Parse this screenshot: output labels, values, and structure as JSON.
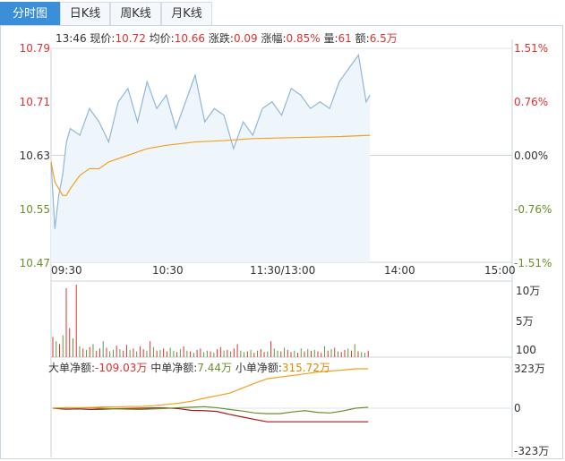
{
  "tabs": [
    {
      "label": "分时图",
      "active": true
    },
    {
      "label": "日K线",
      "active": false
    },
    {
      "label": "周K线",
      "active": false
    },
    {
      "label": "月K线",
      "active": false
    }
  ],
  "quote": {
    "time": "13:46",
    "price_label": "现价:",
    "price": "10.72",
    "avg_label": "均价:",
    "avg": "10.66",
    "change_label": "涨跌:",
    "change": "0.09",
    "pct_label": "涨幅:",
    "pct": "0.85%",
    "volume_label": "量:",
    "volume": "61",
    "amount_label": "额:",
    "amount": "6.5万"
  },
  "price_axis": [
    "10.79",
    "10.71",
    "10.63",
    "10.55",
    "10.47"
  ],
  "pct_axis": [
    "1.51%",
    "0.76%",
    "0.00%",
    "-0.76%",
    "-1.51%"
  ],
  "time_axis": [
    "09:30",
    "10:30",
    "11:30/13:00",
    "14:00",
    "15:00"
  ],
  "volume_axis": [
    "10万",
    "5万",
    "100"
  ],
  "money_flow": {
    "large_label": "大单净额:",
    "large": "-109.03万",
    "medium_label": "中单净额:",
    "medium": "7.44万",
    "small_label": "小单净额:",
    "small": "315.72万",
    "axis": [
      "323万",
      "0",
      "-323万"
    ]
  },
  "colors": {
    "up": "#e03131",
    "down": "#5a9a3a",
    "price_line": "#8fb6dd",
    "avg_line": "#f2a01e",
    "tab_active": "#3b8fd8"
  },
  "chart_data": {
    "type": "line",
    "title": "",
    "xlabel": "",
    "ylabel": "",
    "x_range": [
      "09:30",
      "15:00"
    ],
    "ylim": [
      10.47,
      10.79
    ],
    "prev_close": 10.63,
    "series": [
      {
        "name": "现价",
        "x": [
          "09:30",
          "09:32",
          "09:34",
          "09:36",
          "09:38",
          "09:40",
          "09:45",
          "09:50",
          "09:55",
          "10:00",
          "10:05",
          "10:10",
          "10:15",
          "10:20",
          "10:25",
          "10:30",
          "10:35",
          "10:40",
          "10:45",
          "10:50",
          "10:55",
          "11:00",
          "11:05",
          "11:10",
          "11:15",
          "11:20",
          "11:25",
          "11:30",
          "13:05",
          "13:10",
          "13:15",
          "13:20",
          "13:25",
          "13:30",
          "13:35",
          "13:40",
          "13:44",
          "13:46"
        ],
        "values": [
          10.62,
          10.52,
          10.57,
          10.6,
          10.65,
          10.67,
          10.66,
          10.7,
          10.68,
          10.65,
          10.71,
          10.73,
          10.68,
          10.74,
          10.7,
          10.72,
          10.67,
          10.71,
          10.75,
          10.68,
          10.7,
          10.69,
          10.64,
          10.68,
          10.66,
          10.7,
          10.71,
          10.69,
          10.73,
          10.72,
          10.7,
          10.71,
          10.7,
          10.74,
          10.76,
          10.78,
          10.71,
          10.72
        ]
      },
      {
        "name": "均价",
        "x": [
          "09:30",
          "09:32",
          "09:34",
          "09:36",
          "09:38",
          "09:40",
          "09:45",
          "09:50",
          "09:55",
          "10:00",
          "10:10",
          "10:20",
          "10:30",
          "10:45",
          "11:00",
          "11:15",
          "11:30",
          "13:15",
          "13:30",
          "13:46"
        ],
        "values": [
          10.62,
          10.59,
          10.58,
          10.57,
          10.57,
          10.58,
          10.6,
          10.61,
          10.61,
          10.62,
          10.63,
          10.64,
          10.645,
          10.65,
          10.652,
          10.655,
          10.656,
          10.657,
          10.658,
          10.66
        ]
      }
    ]
  },
  "volume_data": {
    "type": "bar",
    "ylim": [
      0,
      100000
    ],
    "values": [
      28000,
      22000,
      18000,
      30000,
      95000,
      40000,
      26000,
      100000,
      15000,
      12000,
      10000,
      14000,
      18000,
      9000,
      12000,
      22000,
      13000,
      8000,
      10000,
      16000,
      11000,
      9000,
      17000,
      10000,
      12000,
      8000,
      15000,
      11000,
      9000,
      22000,
      14000,
      9000,
      10000,
      12000,
      8000,
      13000,
      9000,
      7000,
      11000,
      15000,
      9000,
      8000,
      6000,
      10000,
      12000,
      7000,
      9000,
      8000,
      6000,
      11000,
      14000,
      9000,
      10000,
      8000,
      12000,
      18000,
      9000,
      7000,
      8000,
      10000,
      6000,
      9000,
      11000,
      7000,
      8000,
      22000,
      12000,
      9000,
      8000,
      13000,
      10000,
      7000,
      9000,
      6000,
      12000,
      8000,
      11000,
      9000,
      10000,
      8000,
      6000,
      15000,
      9000,
      11000,
      13000,
      8000,
      7000,
      10000,
      12000,
      9000,
      18000,
      8000,
      7000,
      6000,
      9000
    ],
    "up": [
      true,
      false,
      true,
      false,
      true,
      true,
      false,
      true,
      false,
      true,
      false,
      true,
      false,
      true,
      true,
      false,
      true,
      false,
      false,
      true,
      false,
      true,
      true,
      false,
      true,
      false,
      true,
      true,
      false,
      true,
      false,
      true,
      false,
      true,
      true,
      false,
      false,
      true,
      false,
      true,
      false,
      true,
      false,
      true,
      true,
      false,
      false,
      true,
      false,
      true,
      true,
      false,
      true,
      false,
      true,
      true,
      false,
      false,
      true,
      false,
      true,
      false,
      true,
      true,
      false,
      true,
      false,
      false,
      true,
      false,
      true,
      true,
      false,
      true,
      false,
      true,
      false,
      true,
      false,
      true,
      true,
      false,
      true,
      false,
      true,
      false,
      true,
      true,
      false,
      true,
      false,
      true,
      false,
      false,
      true
    ]
  },
  "money_flow_data": {
    "type": "line",
    "ylim": [
      -323,
      323
    ],
    "series": [
      {
        "name": "大单净额",
        "values": [
          0,
          -8,
          -6,
          -10,
          -8,
          -4,
          -2,
          0,
          2,
          2,
          -4,
          -18,
          -20,
          -26,
          -50,
          -70,
          -90,
          -109,
          -109,
          -109,
          -109,
          -109,
          -109,
          -109,
          -109,
          -109
        ]
      },
      {
        "name": "中单净额",
        "values": [
          0,
          4,
          2,
          4,
          -2,
          -6,
          -8,
          -10,
          -6,
          -2,
          4,
          8,
          12,
          4,
          -10,
          -22,
          -38,
          -44,
          -44,
          -30,
          -20,
          -34,
          -38,
          -22,
          0,
          7.44
        ]
      },
      {
        "name": "小单净额",
        "values": [
          0,
          4,
          4,
          6,
          10,
          10,
          14,
          14,
          20,
          30,
          40,
          56,
          80,
          100,
          120,
          160,
          200,
          236,
          250,
          262,
          276,
          290,
          298,
          306,
          316,
          315.72
        ]
      }
    ]
  }
}
